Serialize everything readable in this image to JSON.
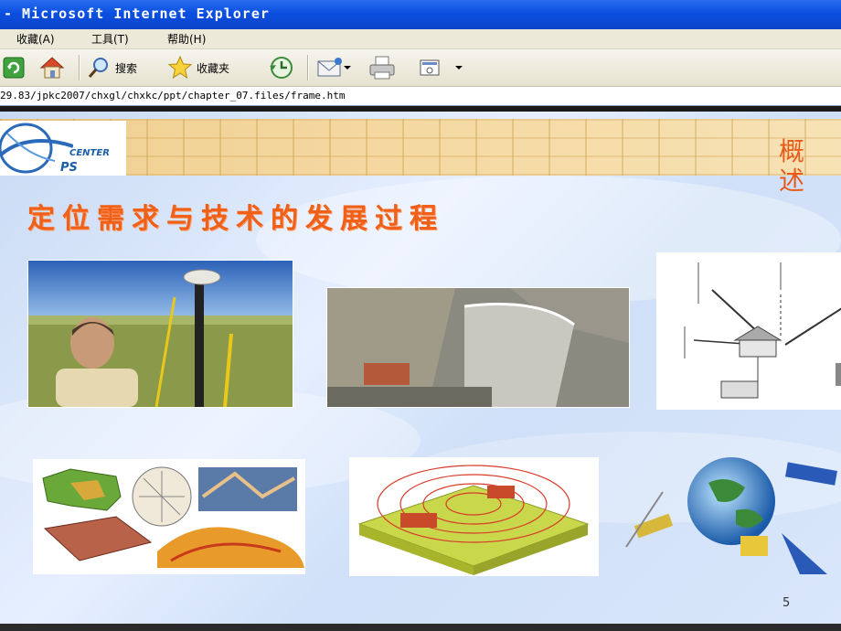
{
  "window": {
    "title": "- Microsoft Internet Explorer"
  },
  "menu": {
    "favorites": "收藏(A)",
    "tools": "工具(T)",
    "help": "帮助(H)"
  },
  "toolbar": {
    "search_label": "搜索",
    "favorites_label": "收藏夹"
  },
  "address": {
    "url": "29.83/jpkc2007/chxgl/chxkc/ppt/chapter_07.files/frame.htm"
  },
  "slide": {
    "logo_center": "CENTER",
    "logo_ps": "PS",
    "side_title": "概述",
    "heading": "定位需求与技术的发展过程",
    "page_number": "5"
  },
  "colors": {
    "titlebar": "#0a4fe0",
    "heading": "#f06018",
    "banner": "#f0cf90"
  }
}
